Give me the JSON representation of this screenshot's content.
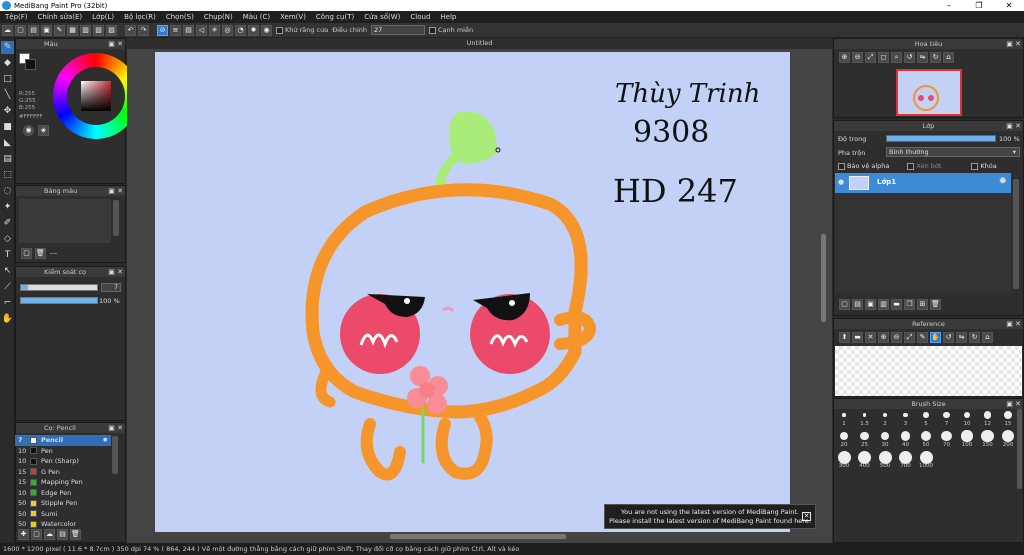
{
  "window": {
    "title": "MediBang Paint Pro (32bit)",
    "min": "–",
    "max": "❐",
    "close": "✕"
  },
  "menu": [
    "Tệp(F)",
    "Chỉnh sửa(E)",
    "Lớp(L)",
    "Bộ lọc(R)",
    "Chọn(S)",
    "Chụp(N)",
    "Màu (C)",
    "Xem(V)",
    "Công cụ(T)",
    "Cửa sổ(W)",
    "Cloud",
    "Help"
  ],
  "toolbar": {
    "antialias_label": "Khử răng cưa",
    "adjust_label": "Điều chỉnh",
    "adjust_value": "27",
    "edge_label": "Cạnh miền"
  },
  "panels": {
    "color": {
      "title": "Màu",
      "r": "R:255",
      "g": "G:255",
      "b": "B:255",
      "hex": "#FFFFFF"
    },
    "palette": {
      "title": "Bảng màu",
      "dash": "---"
    },
    "brush_control": {
      "title": "Kiểm soát cọ",
      "size_value": "7",
      "opacity_value": "100 %",
      "size_fraction": 0.09,
      "opacity_fraction": 1.0
    },
    "brush": {
      "title": "Cọ: Pencil"
    },
    "navigator": {
      "title": "Hoa tiêu"
    },
    "layer": {
      "title": "Lớp",
      "opacity_label": "Độ trong",
      "opacity_value": "100 %",
      "opacity_fraction": 1.0,
      "blend_label": "Pha trộn",
      "blend_value": "Bình thường",
      "protect_alpha": "Bảo vệ alpha",
      "clipping": "Xén bớt",
      "lock": "Khóa",
      "layer_name": "Lớp1"
    },
    "reference": {
      "title": "Reference"
    },
    "brush_size": {
      "title": "Brush Size"
    }
  },
  "brushes": [
    {
      "size": "7",
      "color": "#f0f0f0",
      "name": "Pencil",
      "selected": true
    },
    {
      "size": "10",
      "color": "#111111",
      "name": "Pen"
    },
    {
      "size": "10",
      "color": "#111111",
      "name": "Pen (Sharp)"
    },
    {
      "size": "15",
      "color": "#e03030",
      "name": "G Pen"
    },
    {
      "size": "15",
      "color": "#30b030",
      "name": "Mapping Pen"
    },
    {
      "size": "10",
      "color": "#30b030",
      "name": "Edge Pen"
    },
    {
      "size": "50",
      "color": "#e0d020",
      "name": "Stipple Pen"
    },
    {
      "size": "50",
      "color": "#e0d020",
      "name": "Sumi"
    },
    {
      "size": "50",
      "color": "#e0d020",
      "name": "Watercolor"
    }
  ],
  "brush_sizes": [
    "1",
    "1.5",
    "2",
    "3",
    "5",
    "7",
    "10",
    "12",
    "15",
    "20",
    "25",
    "30",
    "40",
    "50",
    "70",
    "100",
    "150",
    "200",
    "300",
    "400",
    "500",
    "700",
    "1000"
  ],
  "document": {
    "tab": "Untitled"
  },
  "artwork": {
    "line1": "Thùy Trinh",
    "line2": "9308",
    "line3": "HD 247"
  },
  "notice": {
    "line1": "You are not using the latest version of MediBang Paint.",
    "line2": "Please install the latest version of MediBang Paint found here.",
    "close": "✕"
  },
  "status": {
    "text": "1600 * 1200 pixel  ( 11.6 * 8.7cm )  350 dpi  74 %  ( 864, 244 )  Vẽ một đường thẳng bằng cách giữ phím Shift, Thay đổi cỡ cọ bằng cách giữ phím Ctrl, Alt và kéo"
  },
  "colors": {
    "accent": "#2f6fb8",
    "canvas_bg": "#c2d1f5",
    "orange": "#f5952a",
    "cheek": "#ec4a6a",
    "leaf": "#a9ec7a"
  }
}
